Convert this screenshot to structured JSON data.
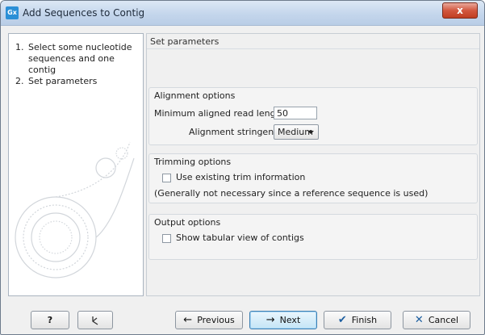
{
  "window": {
    "title": "Add Sequences to Contig",
    "app_icon": "Gx",
    "close_label": "x"
  },
  "steps": [
    {
      "number": "1.",
      "label": "Select some nucleotide sequences and one contig"
    },
    {
      "number": "2.",
      "label": "Set parameters"
    }
  ],
  "panel_title": "Set parameters",
  "alignment": {
    "title": "Alignment options",
    "min_length_label": "Minimum aligned read length:",
    "min_length_value": "50",
    "stringency_label": "Alignment stringency:",
    "stringency_value": "Medium"
  },
  "trimming": {
    "title": "Trimming options",
    "use_trim_label": "Use existing trim information",
    "use_trim_checked": false,
    "note": "(Generally not necessary since a reference sequence is used)"
  },
  "output": {
    "title": "Output options",
    "tabular_label": "Show tabular view of contigs",
    "tabular_checked": false
  },
  "buttons": {
    "help": "?",
    "previous": "Previous",
    "next": "Next",
    "finish": "Finish",
    "cancel": "Cancel"
  },
  "icons": {
    "help": "question-icon",
    "reset": "reset-icon",
    "previous": "arrow-left-icon",
    "next": "arrow-right-icon",
    "finish": "checkmark-icon",
    "cancel": "x-icon"
  }
}
